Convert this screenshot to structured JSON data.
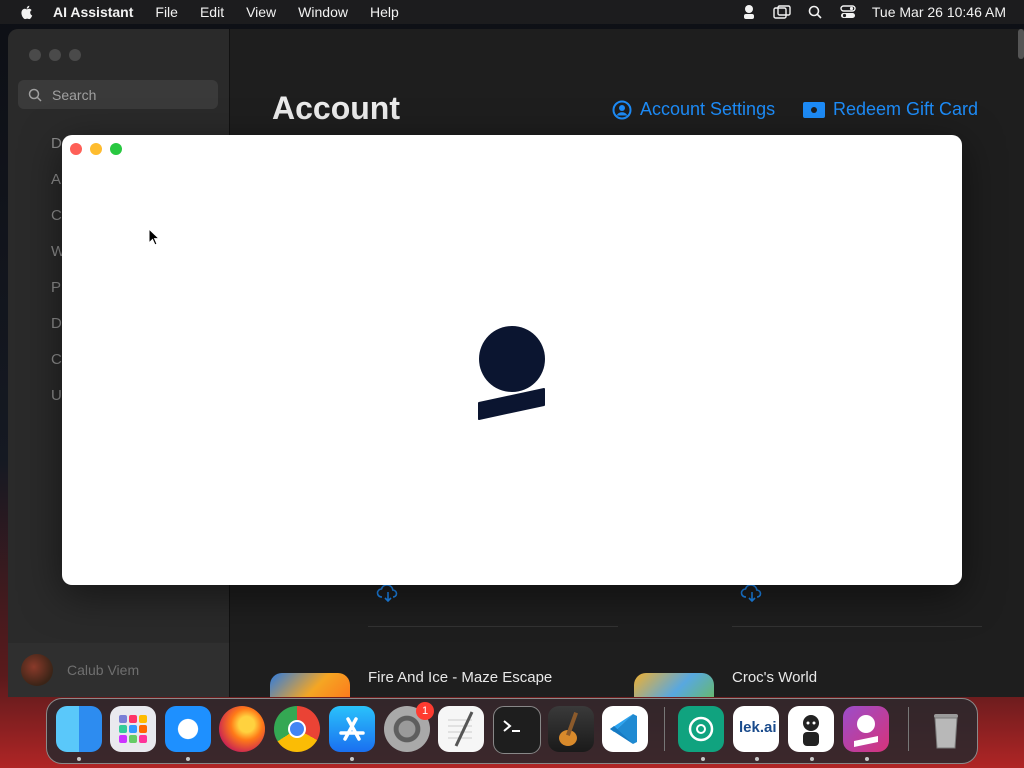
{
  "menubar": {
    "app_name": "AI Assistant",
    "items": [
      "File",
      "Edit",
      "View",
      "Window",
      "Help"
    ],
    "clock": "Tue Mar 26  10:46 AM",
    "status_icons": [
      "user-icon",
      "screen-mirror-icon",
      "search-icon",
      "control-center-icon"
    ]
  },
  "sidebar": {
    "search_placeholder": "Search",
    "nav_items": [
      "D",
      "A",
      "C",
      "W",
      "P",
      "D",
      "C",
      "U"
    ],
    "user_name": "Calub Viem"
  },
  "main": {
    "title": "Account",
    "account_settings_label": "Account Settings",
    "redeem_label": "Redeem Gift Card",
    "apps": [
      {
        "name": "Fire And Ice - Maze Escape"
      },
      {
        "name": "Croc's World"
      }
    ]
  },
  "dialog": {
    "logo_icon": "person-logo-icon"
  },
  "dock": {
    "apps": [
      "Finder",
      "Launchpad",
      "Safari",
      "Firefox",
      "Chrome",
      "App Store",
      "System Settings",
      "TextEdit",
      "Terminal",
      "GarageBand",
      "VS Code",
      "ChatGPT",
      "lek.ai",
      "Character App",
      "AI Assistant",
      "Trash"
    ],
    "settings_badge": "1",
    "lek_label": "lek.ai"
  },
  "colors": {
    "accent": "#1d8cf8",
    "dialog_bg": "#ffffff",
    "logo": "#0b1530"
  }
}
